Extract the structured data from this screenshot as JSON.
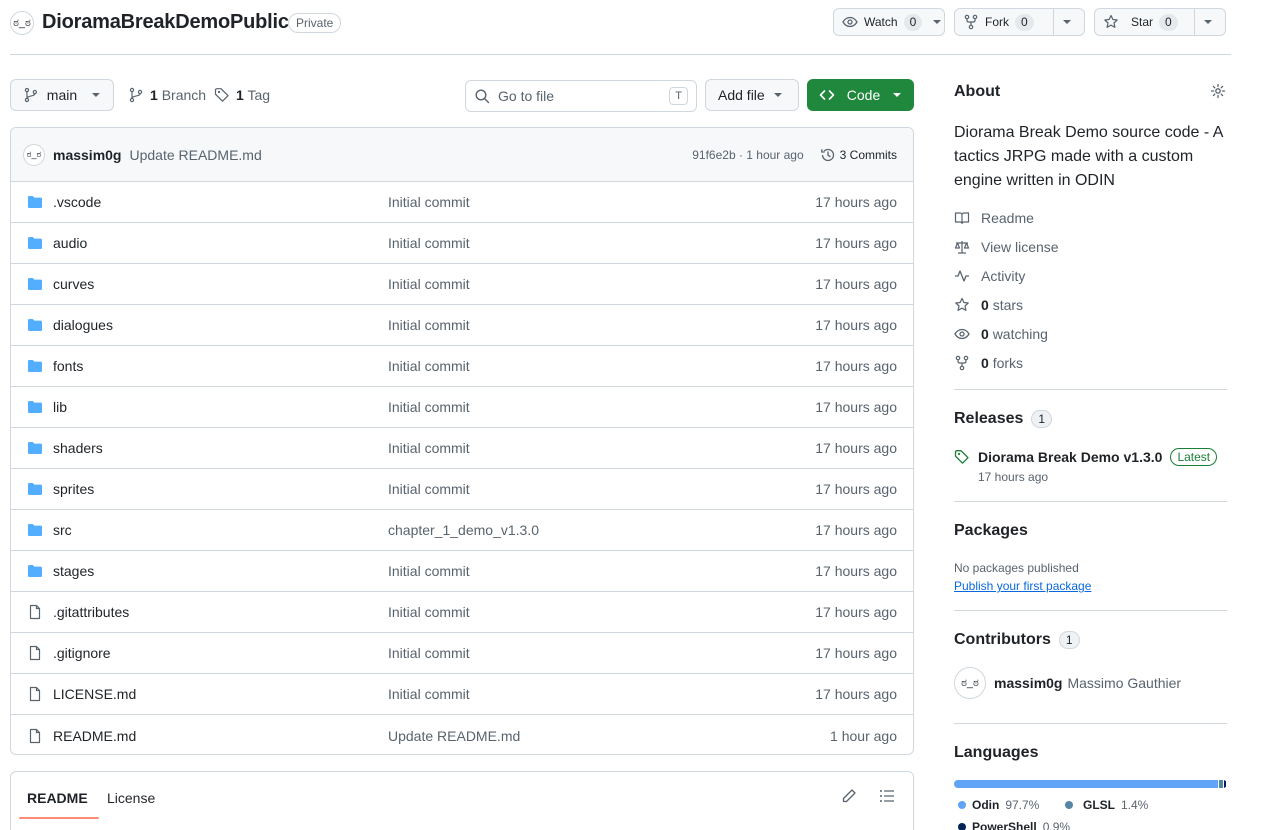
{
  "repo": {
    "name": "DioramaBreakDemoPublic",
    "visibility": "Private",
    "avatar_glyph": "ಠ_ಠ"
  },
  "actions": {
    "watch": {
      "label": "Watch",
      "count": "0"
    },
    "fork": {
      "label": "Fork",
      "count": "0"
    },
    "star": {
      "label": "Star",
      "count": "0"
    }
  },
  "toolbar": {
    "branch": "main",
    "branches_count": "1",
    "branches_label": "Branch",
    "tags_count": "1",
    "tags_label": "Tag",
    "search_placeholder": "Go to file",
    "search_shortcut": "T",
    "add_file": "Add file",
    "code": "Code"
  },
  "latest_commit": {
    "author": "massim0g",
    "message": "Update README.md",
    "meta": "91f6e2b · 1 hour ago",
    "commits_label": "3 Commits"
  },
  "files": [
    {
      "type": "dir",
      "name": ".vscode",
      "message": "Initial commit",
      "time": "17 hours ago"
    },
    {
      "type": "dir",
      "name": "audio",
      "message": "Initial commit",
      "time": "17 hours ago"
    },
    {
      "type": "dir",
      "name": "curves",
      "message": "Initial commit",
      "time": "17 hours ago"
    },
    {
      "type": "dir",
      "name": "dialogues",
      "message": "Initial commit",
      "time": "17 hours ago"
    },
    {
      "type": "dir",
      "name": "fonts",
      "message": "Initial commit",
      "time": "17 hours ago"
    },
    {
      "type": "dir",
      "name": "lib",
      "message": "Initial commit",
      "time": "17 hours ago"
    },
    {
      "type": "dir",
      "name": "shaders",
      "message": "Initial commit",
      "time": "17 hours ago"
    },
    {
      "type": "dir",
      "name": "sprites",
      "message": "Initial commit",
      "time": "17 hours ago"
    },
    {
      "type": "dir",
      "name": "src",
      "message": "chapter_1_demo_v1.3.0",
      "time": "17 hours ago"
    },
    {
      "type": "dir",
      "name": "stages",
      "message": "Initial commit",
      "time": "17 hours ago"
    },
    {
      "type": "file",
      "name": ".gitattributes",
      "message": "Initial commit",
      "time": "17 hours ago"
    },
    {
      "type": "file",
      "name": ".gitignore",
      "message": "Initial commit",
      "time": "17 hours ago"
    },
    {
      "type": "file",
      "name": "LICENSE.md",
      "message": "Initial commit",
      "time": "17 hours ago"
    },
    {
      "type": "file",
      "name": "README.md",
      "message": "Update README.md",
      "time": "1 hour ago"
    }
  ],
  "readme_tabs": {
    "readme": "README",
    "license": "License"
  },
  "about": {
    "title": "About",
    "description": "Diorama Break Demo source code - A tactics JRPG made with a custom engine written in ODIN",
    "readme": "Readme",
    "license": "View license",
    "activity": "Activity",
    "stars_count": "0",
    "stars_label": "stars",
    "watching_count": "0",
    "watching_label": "watching",
    "forks_count": "0",
    "forks_label": "forks"
  },
  "releases": {
    "title": "Releases",
    "count": "1",
    "name": "Diorama Break Demo v1.3.0",
    "badge": "Latest",
    "time": "17 hours ago"
  },
  "packages": {
    "title": "Packages",
    "empty": "No packages published",
    "link": "Publish your first package"
  },
  "contributors": {
    "title": "Contributors",
    "count": "1",
    "login": "massim0g",
    "name": "Massimo Gauthier"
  },
  "languages": {
    "title": "Languages",
    "items": [
      {
        "name": "Odin",
        "percent": "97.7%",
        "value": 97.7,
        "color": "#60a5f5"
      },
      {
        "name": "GLSL",
        "percent": "1.4%",
        "value": 1.4,
        "color": "#5686a5"
      },
      {
        "name": "PowerShell",
        "percent": "0.9%",
        "value": 0.9,
        "color": "#012456"
      }
    ]
  },
  "colors": {
    "primary_button": "#1f883d",
    "link": "#0969da",
    "folder": "#54aeff"
  }
}
